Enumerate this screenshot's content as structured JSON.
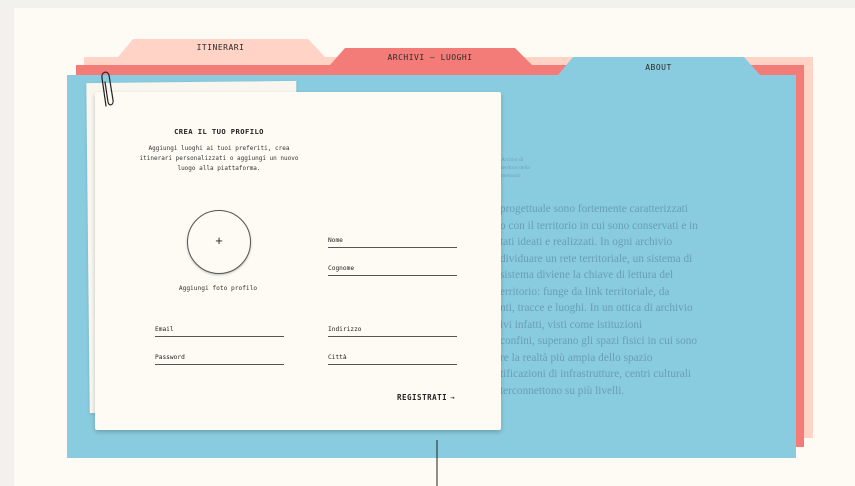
{
  "tabs": [
    {
      "label": "ITINERARI"
    },
    {
      "label": "ARCHIVI — LUOGHI"
    },
    {
      "label": "ABOUT"
    }
  ],
  "colors": {
    "pink": "#ffd3c6",
    "coral": "#f47c78",
    "blue": "#8accdf",
    "paper": "#fdfbf4"
  },
  "background": {
    "small_lines": [
      "Archivi di",
      "territori della",
      "memoria"
    ],
    "paragraph": [
      "progettuale sono fortemente caratterizzati",
      "o con il territorio in cui sono conservati e in",
      "tati ideati e realizzati. In ogni archivio",
      "dividuare un rete territoriale, un sistema di",
      "sistema diviene la chiave di lettura del",
      "erritorio: funge da link territoriale, da",
      "nti, tracce e luoghi. In un ottica di archivio",
      "ivi infatti, visti come istituzioni",
      "confini, superano gli spazi fisici in cui sono",
      "re la realtà più ampia dello spazio",
      "tificazioni di infrastrutture, centri culturali",
      "terconnettono su più livelli."
    ]
  },
  "form": {
    "title": "CREA IL TUO PROFILO",
    "description": "Aggiungi luoghi ai tuoi preferiti, crea itinerari personalizzati o aggiungi un nuovo luogo alla piattaforma.",
    "avatar_plus": "+",
    "avatar_label": "Aggiungi foto profilo",
    "fields": {
      "nome": "Nome",
      "cognome": "Cognome",
      "email": "Email",
      "password": "Password",
      "indirizzo": "Indirizzo",
      "citta": "Città"
    },
    "submit_label": "REGISTRATI",
    "submit_arrow": "→"
  }
}
